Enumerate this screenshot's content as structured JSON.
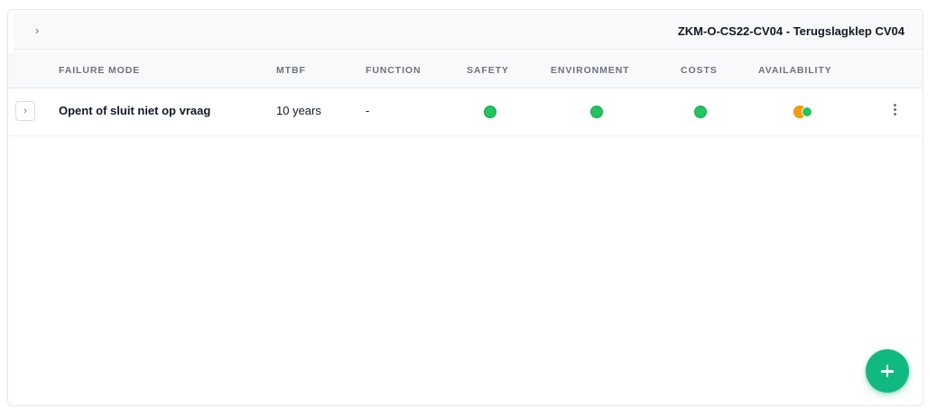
{
  "header": {
    "chevron_icon": "chevron-right-icon",
    "title": "ZKM-O-CS22-CV04 - Terugslagklep CV04"
  },
  "table": {
    "columns": [
      "FAILURE MODE",
      "MTBF",
      "FUNCTION",
      "SAFETY",
      "ENVIRONMENT",
      "COSTS",
      "AVAILABILITY"
    ],
    "rows": [
      {
        "failure_mode": "Opent of sluit niet op vraag",
        "mtbf": "10 years",
        "function": "-",
        "safety": "green",
        "environment": "green",
        "costs": "green",
        "availability": [
          "orange",
          "green"
        ]
      }
    ]
  },
  "colors": {
    "green": "#22c55e",
    "orange": "#f59e0b",
    "fab": "#10b981"
  },
  "actions": {
    "row_menu_icon": "kebab-menu-icon",
    "add_icon": "plus-icon"
  }
}
